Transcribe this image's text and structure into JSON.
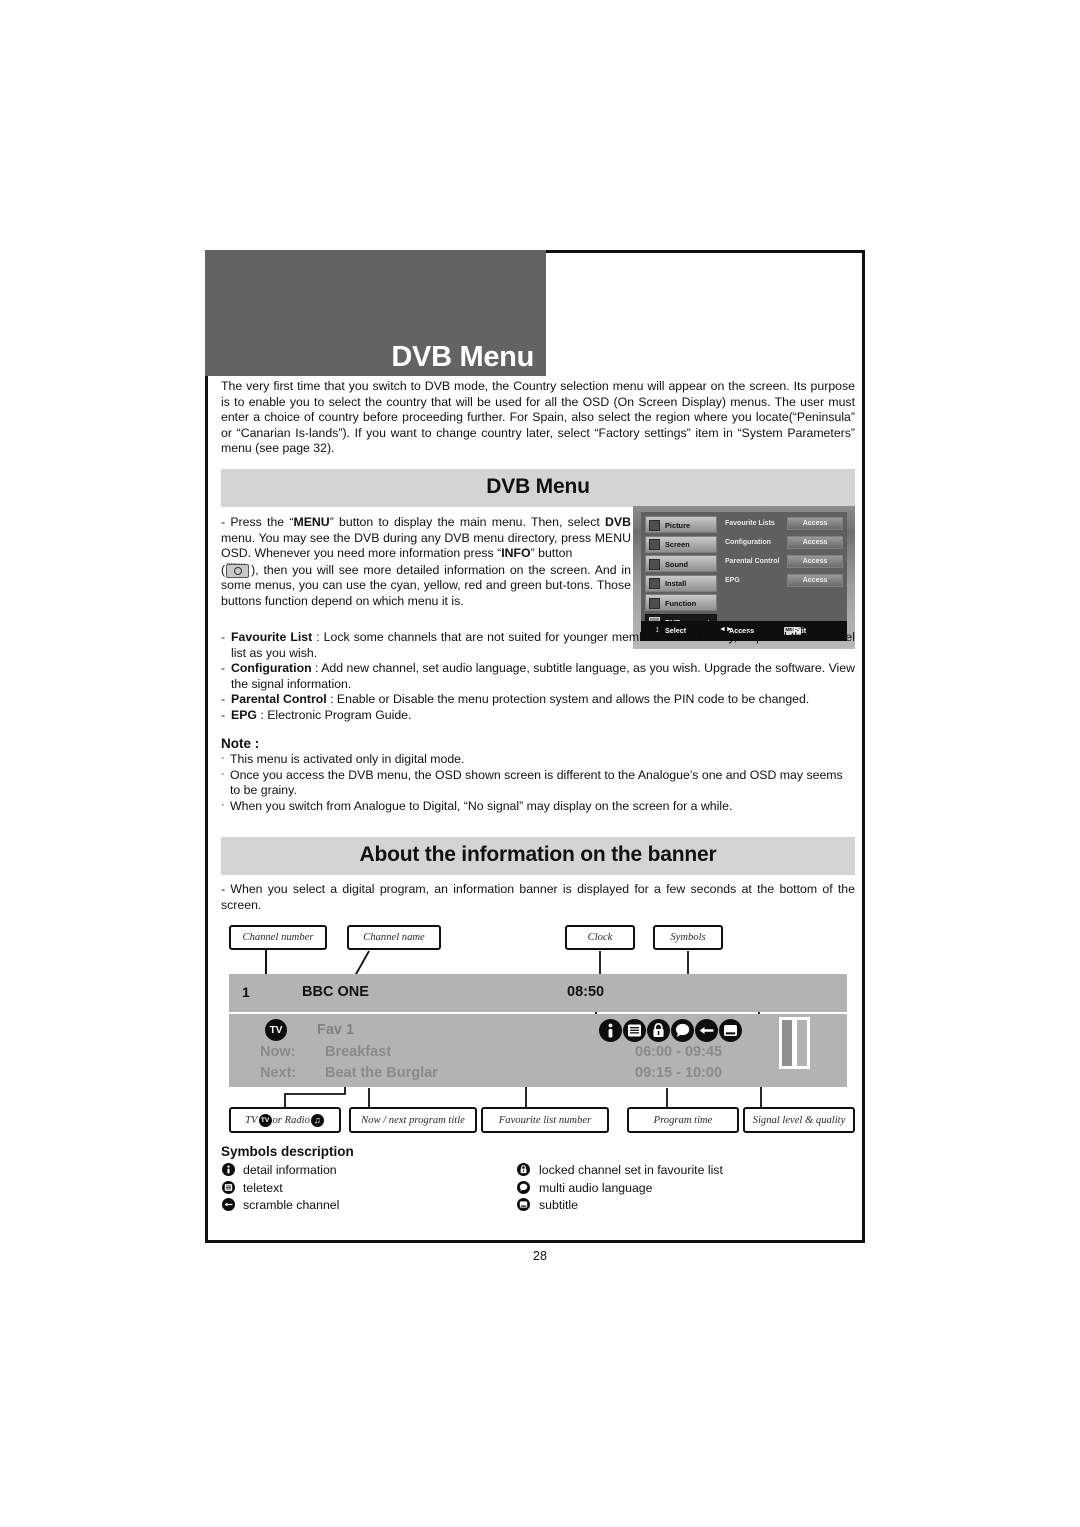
{
  "document": {
    "page_number": "28",
    "header_title": "DVB Menu"
  },
  "intro": {
    "text": "The very first time that you switch to DVB mode, the Country selection menu will appear on the screen. Its purpose is to enable you to select the country that will be used for all the OSD (On Screen Display) menus. The user must enter a choice of country before proceeding further. For Spain, also select the region where you locate(“Peninsula” or “Canarian Is-lands”). If you want to change country later, select “Factory settings” item in “System Parameters” menu (see page 32)."
  },
  "dvb_section": {
    "bar_title": "DVB Menu",
    "press_menu": {
      "part1": "- Press the “",
      "menu_bold": "MENU",
      "part2": "” button to display the main menu. Then, select ",
      "dvb_bold": "DVB",
      "part3": " menu. You may see the DVB during any DVB menu directory, press MENU OSD. Whenever you need more information press “",
      "info_bold": "INFO",
      "part4": "” button",
      "part5": "(",
      "recall_label": "RECALL",
      "part6": "), then you will see more detailed information on the screen. And in some menus, you can use the cyan, yellow, red and green but-tons. Those buttons function depend on which menu it is."
    },
    "items": [
      {
        "dash": "-",
        "term": "Favourite List",
        "sep": " : ",
        "desc": "Lock some channels that are not suited for younger members of the family, skip/add the channel list as you wish."
      },
      {
        "dash": "-",
        "term": "Configuration",
        "sep": " : ",
        "desc": "Add new channel, set audio language, subtitle language, as you wish. Upgrade the software. View the signal information."
      },
      {
        "dash": "-",
        "term": "Parental Control",
        "sep": " : ",
        "desc": "Enable or Disable the menu protection system and allows the PIN code to be changed."
      },
      {
        "dash": "-",
        "term": "EPG",
        "sep": " : ",
        "desc": "Electronic Program Guide."
      }
    ],
    "note": {
      "title": "Note :",
      "bullets": [
        "This menu is activated only in digital mode.",
        "Once you access the DVB menu, the OSD shown screen is different to the Analogue’s one and OSD may seems to be grainy.",
        "When you switch from Analogue to Digital, “No signal” may display on the screen for a while."
      ]
    }
  },
  "osd_mock": {
    "menu_items": [
      {
        "label": "Picture",
        "selected": false
      },
      {
        "label": "Screen",
        "selected": false
      },
      {
        "label": "Sound",
        "selected": false
      },
      {
        "label": "Install",
        "selected": false
      },
      {
        "label": "Function",
        "selected": false
      },
      {
        "label": "DVB",
        "selected": true
      }
    ],
    "sub_items": [
      {
        "name": "Favourite Lists",
        "action": "Access"
      },
      {
        "name": "Configuration",
        "action": "Access"
      },
      {
        "name": "Parental Control",
        "action": "Access"
      },
      {
        "name": "EPG",
        "action": "Access"
      }
    ],
    "footer": {
      "select": "Select",
      "access": "Access",
      "exit": "Exit",
      "menu_key": "MENU"
    }
  },
  "banner_section": {
    "bar_title": "About the information on the banner",
    "intro": "- When you select a digital program, an information banner is displayed for a few seconds at the bottom of the screen.",
    "callouts": {
      "channel_number": "Channel number",
      "channel_name": "Channel name",
      "clock": "Clock",
      "symbols": "Symbols",
      "tv_or_radio_pre": "TV ",
      "tv_or_radio_mid": " or Radio ",
      "tv_badge": "TV",
      "radio_badge": "♫",
      "now_next": "Now / next program title",
      "fav_list_number": "Favourite list number",
      "program_time": "Program time",
      "signal": "Signal level & quality"
    },
    "banner": {
      "channel_number": "1",
      "channel_name": "BBC ONE",
      "clock": "08:50",
      "tv_badge": "TV",
      "fav": "Fav 1",
      "now_label": "Now:",
      "now_title": "Breakfast",
      "now_time": "06:00 - 09:45",
      "next_label": "Next:",
      "next_title": "Beat the Burglar",
      "next_time": "09:15 - 10:00"
    },
    "symbol_icons": [
      "info-icon",
      "teletext-icon",
      "lock-icon",
      "audio-bubble-icon",
      "scramble-icon",
      "subtitle-icon"
    ]
  },
  "symbols_description": {
    "title": "Symbols description",
    "left": [
      {
        "icon": "info-icon",
        "label": "detail information"
      },
      {
        "icon": "teletext-icon",
        "label": "teletext"
      },
      {
        "icon": "scramble-icon",
        "label": "scramble channel"
      }
    ],
    "right": [
      {
        "icon": "lock-icon",
        "label": "locked channel set in favourite list"
      },
      {
        "icon": "audio-bubble-icon",
        "label": "multi audio language"
      },
      {
        "icon": "subtitle-icon",
        "label": "subtitle"
      }
    ]
  },
  "colors": {
    "header_dark": "#636363",
    "section_bar": "#d4d4d4",
    "banner_gray": "#b3b3b3",
    "banner_text_gray": "#8a8a8a",
    "ink": "#111111"
  }
}
